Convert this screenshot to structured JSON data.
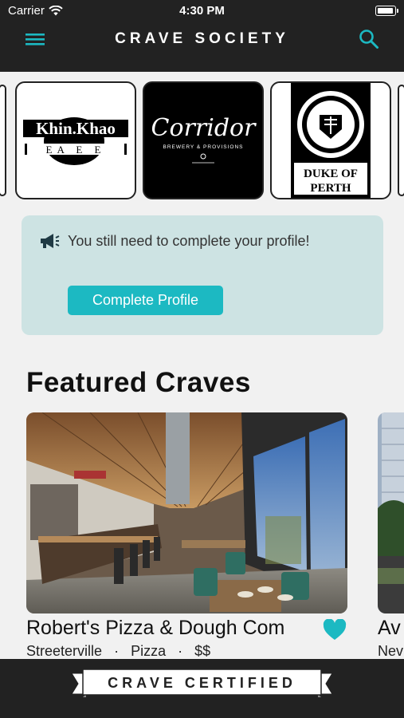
{
  "status_bar": {
    "carrier": "Carrier",
    "time": "4:30 PM"
  },
  "header": {
    "title": "CRAVE SOCIETY",
    "menu_icon": "hamburger-menu-icon",
    "search_icon": "search-icon"
  },
  "logos": [
    {
      "name": "Khin Khao",
      "text": "Khin.Khao",
      "sub": "EA  E  E"
    },
    {
      "name": "Corridor",
      "text": "Corridor",
      "sub": "BREWERY & PROVISIONS"
    },
    {
      "name": "Duke of Perth",
      "text": "DUKE OF PERTH"
    }
  ],
  "banner": {
    "message": "You still need to complete your profile!",
    "button_label": "Complete Profile",
    "icon": "megaphone-icon"
  },
  "featured": {
    "title": "Featured Craves",
    "cards": [
      {
        "name": "Robert's Pizza & Dough Com",
        "neighborhood": "Streeterville",
        "cuisine": "Pizza",
        "price": "$$",
        "favorited": true
      },
      {
        "name": "Av",
        "neighborhood": "Nev"
      }
    ]
  },
  "footer": {
    "label": "CRAVE CERTIFIED"
  },
  "colors": {
    "accent": "#1cb9c2",
    "dark": "#222222",
    "banner_bg": "#cde3e3"
  }
}
